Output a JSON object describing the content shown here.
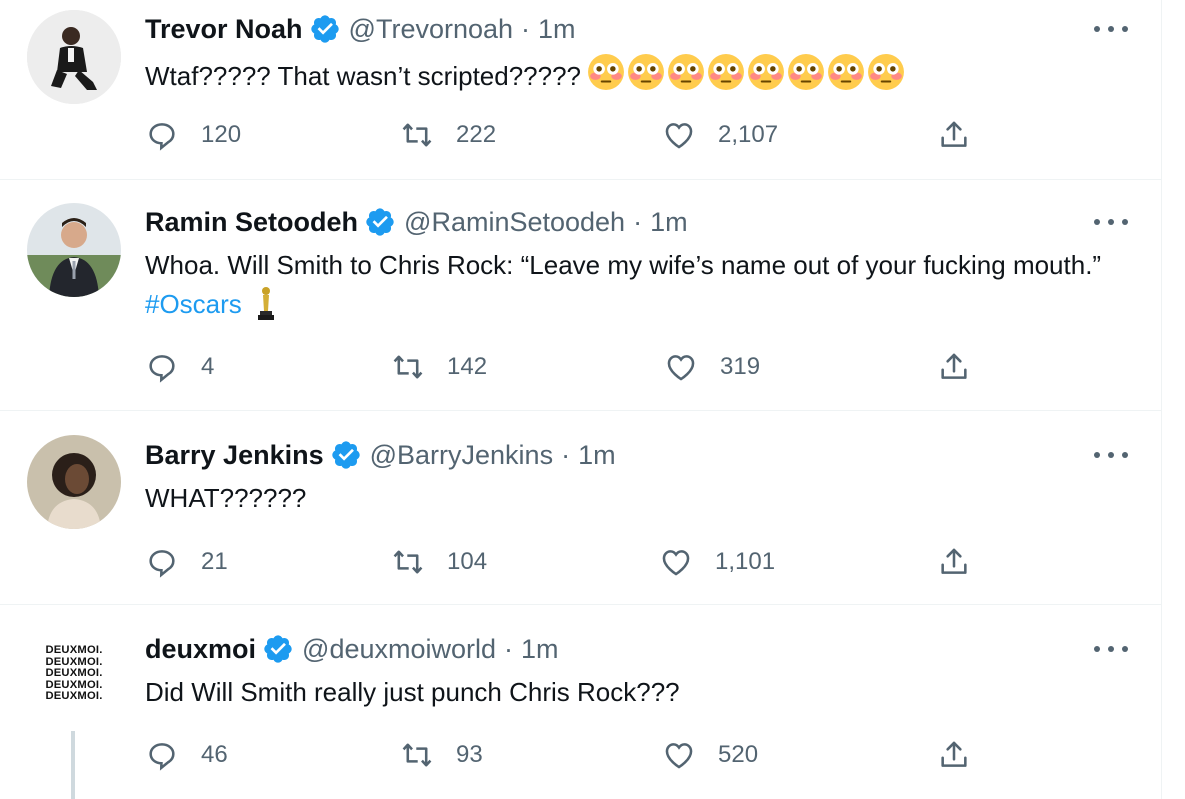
{
  "tweets": [
    {
      "name": "Trevor Noah",
      "handle": "@Trevornoah",
      "separator": "·",
      "time": "1m",
      "text": "Wtaf????? That wasn’t scripted?????",
      "emoji_count": 8,
      "emoji": "flushed-face",
      "replies": "120",
      "retweets": "222",
      "likes": "2,107"
    },
    {
      "name": "Ramin Setoodeh",
      "handle": "@RaminSetoodeh",
      "separator": "·",
      "time": "1m",
      "text": "Whoa. Will Smith to Chris Rock: “Leave my wife’s name out of your fucking mouth.”",
      "hashtag": "#Oscars",
      "emoji": "trophy-statue",
      "replies": "4",
      "retweets": "142",
      "likes": "319"
    },
    {
      "name": "Barry Jenkins",
      "handle": "@BarryJenkins",
      "separator": "·",
      "time": "1m",
      "text": "WHAT??????",
      "replies": "21",
      "retweets": "104",
      "likes": "1,101"
    },
    {
      "name": "deuxmoi",
      "handle": "@deuxmoiworld",
      "separator": "·",
      "time": "1m",
      "text": "Did Will Smith really just punch Chris Rock???",
      "logo_lines": [
        "DEUXMOI.",
        "DEUXMOI.",
        "DEUXMOI.",
        "DEUXMOI.",
        "DEUXMOI."
      ],
      "replies": "46",
      "retweets": "93",
      "likes": "520"
    }
  ],
  "colors": {
    "verified": "#1d9bf0",
    "hashtag": "#1d9bf0",
    "secondary_text": "#536471",
    "divider": "#eff3f4"
  },
  "icons": [
    "reply-icon",
    "retweet-icon",
    "like-icon",
    "share-icon",
    "more-icon",
    "verified-badge-icon"
  ]
}
